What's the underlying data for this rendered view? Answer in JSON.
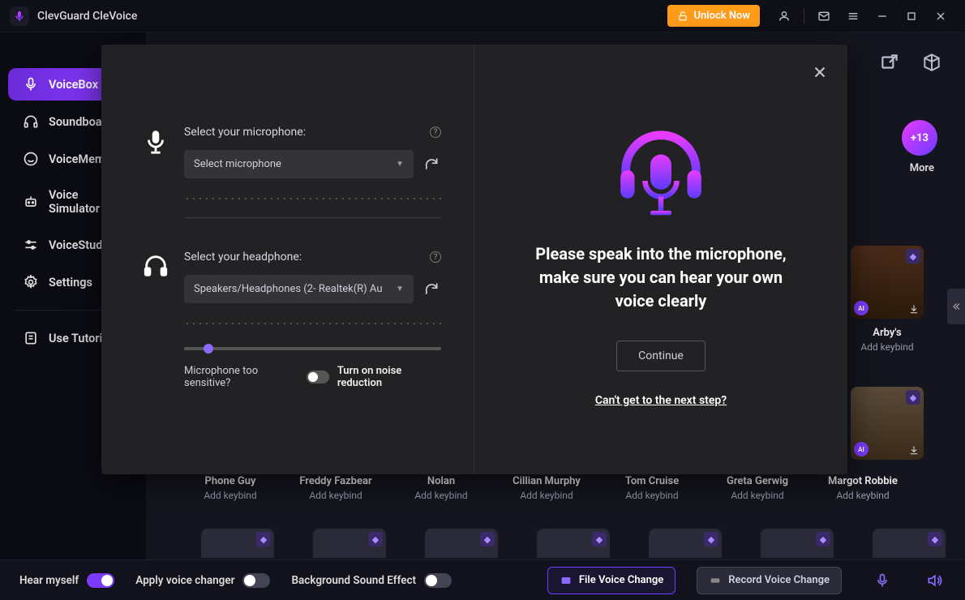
{
  "app": {
    "title": "ClevGuard CleVoice"
  },
  "titlebar": {
    "unlock": "Unlock Now"
  },
  "sidebar": {
    "items": [
      {
        "label": "VoiceBox"
      },
      {
        "label": "Soundboard"
      },
      {
        "label": "VoiceMeme"
      },
      {
        "label": "Voice Simulator"
      },
      {
        "label": "VoiceStudio"
      },
      {
        "label": "Settings"
      }
    ],
    "tutorial": "Use Tutorial"
  },
  "more": {
    "badge": "+13",
    "label": "More"
  },
  "cards": [
    {
      "name": "Phone Guy",
      "sub": "Add keybind"
    },
    {
      "name": "Freddy Fazbear",
      "sub": "Add keybind"
    },
    {
      "name": "Nolan",
      "sub": "Add keybind"
    },
    {
      "name": "Cillian Murphy",
      "sub": "Add keybind"
    },
    {
      "name": "Tom Cruise",
      "sub": "Add keybind"
    },
    {
      "name": "Greta Gerwig",
      "sub": "Add keybind"
    },
    {
      "name": "Margot Robbie",
      "sub": "Add keybind"
    }
  ],
  "cards_top": [
    {
      "name": "Arby's",
      "sub": "Add keybind"
    }
  ],
  "bottom": {
    "hear": "Hear myself",
    "apply": "Apply voice changer",
    "bg": "Background Sound Effect",
    "file": "File Voice Change",
    "record": "Record Voice Change"
  },
  "modal": {
    "mic_label": "Select your microphone:",
    "mic_placeholder": "Select microphone",
    "hp_label": "Select your headphone:",
    "hp_value": "Speakers/Headphones (2- Realtek(R) Au",
    "sensitive": "Microphone too sensitive?",
    "noise": "Turn on noise reduction",
    "msg": "Please speak into the microphone, make sure you can hear your own voice clearly",
    "continue": "Continue",
    "help": "Can't get to the next step?"
  }
}
